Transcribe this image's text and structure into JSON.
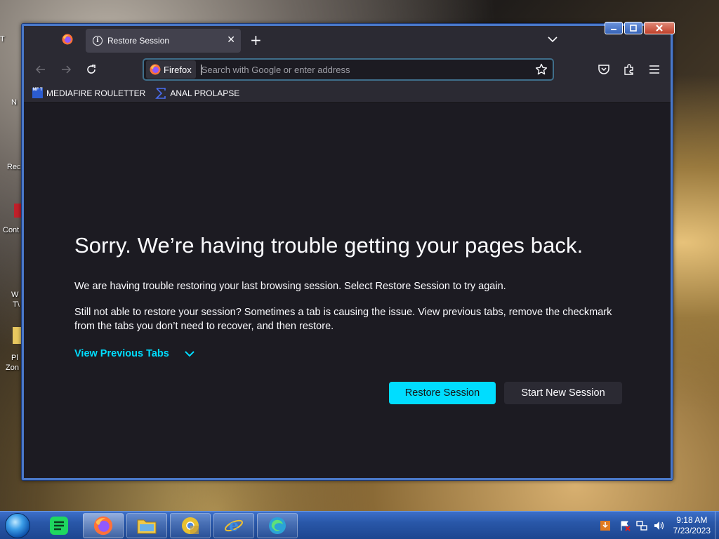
{
  "desktop": {
    "icon_labels": [
      "T",
      "N",
      "Rec",
      "Cont",
      "W",
      "T\\",
      "Pl",
      "Zon"
    ]
  },
  "window": {
    "tab": {
      "title": "Restore Session"
    },
    "new_tab_label": "+",
    "urlbar": {
      "identity_label": "Firefox",
      "placeholder": "Search with Google or enter address",
      "value": ""
    },
    "bookmarks": [
      {
        "icon_text": "MF T",
        "label": "MEDIAFIRE ROULETTER"
      },
      {
        "icon_text": "",
        "label": "ANAL PROLAPSE"
      }
    ]
  },
  "content": {
    "heading": "Sorry. We’re having trouble getting your pages back.",
    "paragraph1": "We are having trouble restoring your last browsing session. Select Restore Session to try again.",
    "paragraph2": "Still not able to restore your session? Sometimes a tab is causing the issue. View previous tabs, remove the checkmark from the tabs you don’t need to recover, and then restore.",
    "view_previous": "View Previous Tabs",
    "restore_button": "Restore Session",
    "new_session_button": "Start New Session"
  },
  "taskbar": {
    "time": "9:18 AM",
    "date": "7/23/2023"
  },
  "colors": {
    "accent": "#00ddff",
    "window_frame": "#4a78c8",
    "content_bg": "#1c1b22",
    "toolbar_bg": "#2b2a33"
  }
}
